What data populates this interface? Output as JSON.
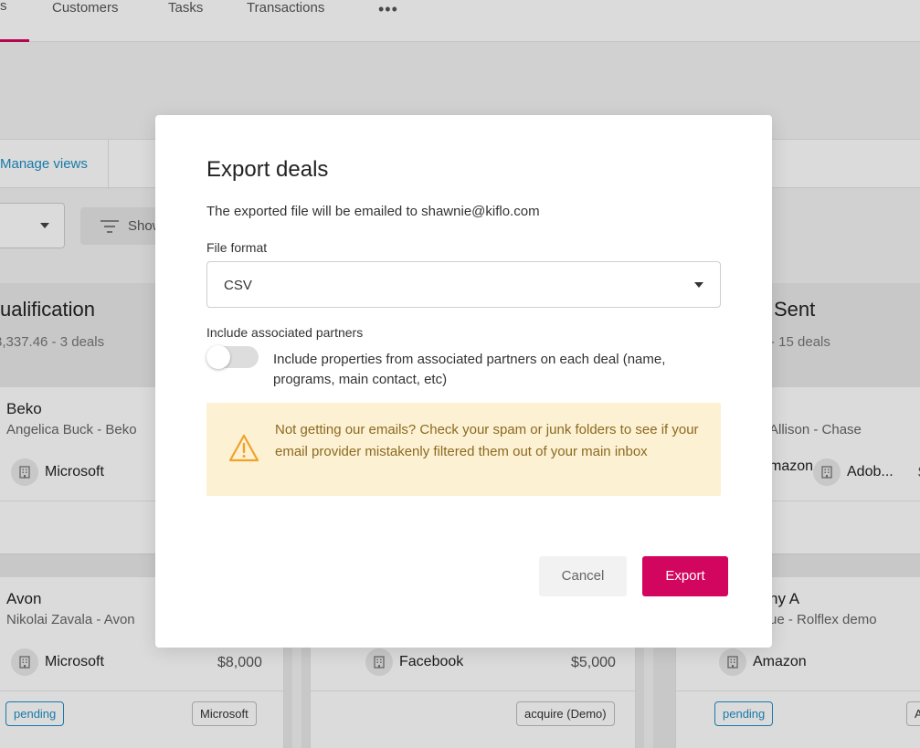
{
  "nav": {
    "active_tab_stub": "s",
    "tabs": [
      "Customers",
      "Tasks",
      "Transactions"
    ],
    "more": "•••"
  },
  "views_bar": {
    "manage_views": "Manage views"
  },
  "toolbar": {
    "show_label": "Show"
  },
  "columns": [
    {
      "title": "ualification",
      "subtitle": "3,337.46 - 3 deals",
      "cards": [
        {
          "title": "Beko",
          "subtitle": "Angelica Buck - Beko",
          "company": "Microsoft",
          "amount": ""
        },
        {
          "title": "Avon",
          "subtitle": "Nikolai Zavala - Avon",
          "company": "Microsoft",
          "amount": "$8,000",
          "status": "pending",
          "tag": "Microsoft"
        }
      ]
    },
    {
      "cards": [
        {
          "company": "Facebook",
          "amount": "$5,000",
          "tag": "acquire (Demo)"
        }
      ]
    },
    {
      "title": "Sent",
      "subtitle": "- 15 deals",
      "cards": [
        {
          "subtitle": "Allison - Chase",
          "company": "mazon",
          "company2": "Adob...",
          "extra": "$"
        },
        {
          "title": "ny A",
          "subtitle": "ue - Rolflex demo",
          "company": "Amazon",
          "status": "pending",
          "tag": "A"
        }
      ]
    }
  ],
  "modal": {
    "title": "Export deals",
    "info": "The exported file will be emailed to shawnie@kiflo.com",
    "file_format_label": "File format",
    "file_format_value": "CSV",
    "partners_label": "Include associated partners",
    "partners_toggle_on": false,
    "partners_desc": "Include properties from associated partners on each deal (name, programs, main contact, etc)",
    "warning": "Not getting our emails? Check your spam or junk folders to see if your email provider mistakenly filtered them out of your main inbox",
    "cancel": "Cancel",
    "export": "Export"
  },
  "colors": {
    "accent": "#d3065f",
    "link": "#1e8fc6",
    "warning_bg": "#fdf1d4",
    "warning_icon": "#f0a22a"
  },
  "icons": [
    "filter-icon",
    "building-icon",
    "warning-icon",
    "chevron-down-icon",
    "more-icon"
  ]
}
